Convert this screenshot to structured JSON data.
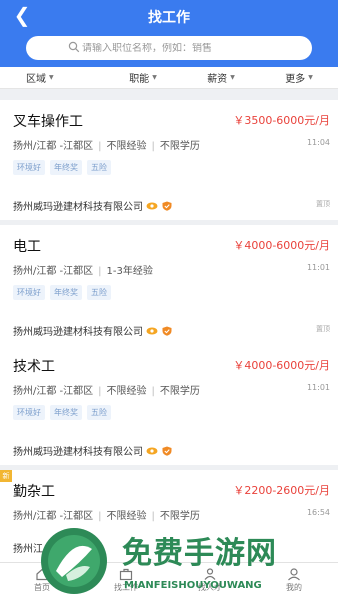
{
  "header": {
    "title": "找工作",
    "search_placeholder": "请输入职位名称，例如：销售"
  },
  "filters": [
    "区域",
    "职能",
    "薪资",
    "更多"
  ],
  "jobs": [
    {
      "title": "叉车操作工",
      "salary": "￥3500-6000元/月",
      "location": "扬州/江都 -江都区",
      "experience": "不限经验",
      "education": "不限学历",
      "time": "11:04",
      "tags": [
        "环境好",
        "年终奖",
        "五险"
      ],
      "company": "扬州威玛逊建材科技有限公司",
      "report": "置顶"
    },
    {
      "title": "电工",
      "salary": "￥4000-6000元/月",
      "location": "扬州/江都 -江都区",
      "experience": "1-3年经验",
      "education": "",
      "time": "11:01",
      "tags": [
        "环境好",
        "年终奖",
        "五险"
      ],
      "company": "扬州威玛逊建材科技有限公司",
      "report": "置顶"
    },
    {
      "title": "技术工",
      "salary": "￥4000-6000元/月",
      "location": "扬州/江都 -江都区",
      "experience": "不限经验",
      "education": "不限学历",
      "time": "11:01",
      "tags": [
        "环境好",
        "年终奖",
        "五险"
      ],
      "company": "扬州威玛逊建材科技有限公司",
      "report": "置顶"
    },
    {
      "title": "勤杂工",
      "salary": "￥2200-2600元/月",
      "location": "扬州/江都 -江都区",
      "experience": "不限经验",
      "education": "不限学历",
      "time": "16:54",
      "tags": [],
      "company": "扬州江",
      "report": "",
      "new_flag": "新"
    }
  ],
  "tabbar": [
    "首页",
    "找工作",
    "找人才",
    "我的"
  ],
  "watermark": {
    "cn": "免费手游网",
    "en": "MIANFEISHOUYOUWANG"
  },
  "colors": {
    "primary": "#3a7bef",
    "salary": "#e9423b",
    "tag_text": "#7d9fcc",
    "watermark": "#2d8a57"
  }
}
